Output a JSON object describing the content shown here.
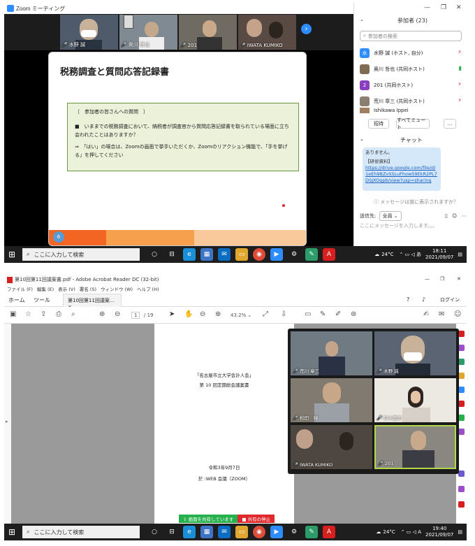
{
  "top": {
    "zoom_title": "Zoom ミーティング",
    "thumbnails": [
      {
        "name": "水野 誠",
        "bg": "#4f5a6a"
      },
      {
        "name": "奥川 哲也",
        "bg": "#7f8a92"
      },
      {
        "name": "201",
        "bg": "#6f6a62"
      },
      {
        "name": "IWATA KUMIKO",
        "bg": "#5a4a44"
      }
    ],
    "slide": {
      "title": "税務調査と質問応答記録書",
      "box_heading": "〔　参加者の皆さんへの質問　〕",
      "box_question": "■　いままでの税務調査において、納税者が調査官から質問応答記録書を取られている場面に立ち会われたことはありますか？",
      "box_instruction": "⇒　「はい」の場合は、Zoomの画面で挙手いただくか、Zoomのリアクション機能で、「手を挙げる」を押してください",
      "page_number": "6",
      "bar_colors": [
        "#f26522",
        "#f6a04d",
        "#f9c99b"
      ]
    },
    "panel": {
      "participants_label": "参加者 (23)",
      "search_placeholder": "参加者の検索",
      "participants": [
        {
          "initial": "水",
          "name": "水野 誠 (ホスト, 自分)",
          "color": "#2d8cff"
        },
        {
          "initial": "",
          "name": "奥川 哲也 (共同ホスト)",
          "color": "#7f6a52"
        },
        {
          "initial": "2",
          "name": "201 (共同ホスト)",
          "color": "#8a3fc0"
        },
        {
          "initial": "",
          "name": "荒川 章三 (共同ホスト)",
          "color": "#8c7f70"
        },
        {
          "initial": "",
          "name": "Ishikawa Ippei",
          "color": "#a08060"
        }
      ],
      "invite_label": "招待",
      "mute_all_label": "すべてミュート",
      "more_label": "...",
      "chat_label": "チャット",
      "chat_text_1": "ありません。",
      "chat_text_2": "【研修資料】",
      "chat_link": "https://drive.google.com/file/d/1eEh9BZvSSLuFhowS9EkR2PL7DSJXOgpb/view?usp=sharing",
      "chat_warning": "メッセージは誰に表示されますか？",
      "send_to_label": "送信先:",
      "send_to_value": "全員",
      "chat_input_placeholder": "ここにメッセージを入力します。。。"
    },
    "taskbar": {
      "search_placeholder": "ここに入力して検索",
      "temp": "24°C",
      "time": "18:11",
      "date": "2021/09/07"
    }
  },
  "bottom": {
    "window_title": "第10回第11回議案書.pdf - Adobe Acrobat Reader DC (32-bit)",
    "menu": [
      "ファイル (F)",
      "編集 (E)",
      "表示 (V)",
      "署名 (S)",
      "ウィンドウ (W)",
      "ヘルプ (H)"
    ],
    "tab_home": "ホーム",
    "tab_tools": "ツール",
    "doc_tab": "第10回第11回議案...",
    "login": "ログイン",
    "page_current": "1",
    "page_total": "/ 19",
    "zoom": "43.2%",
    "page_text": {
      "line1": "「名古屋市立大学会計人会」",
      "line2": "第 10 回定期総会議案書",
      "date": "令和3年9月7日",
      "venue": "於 :WEB 会議（ZOOM）"
    },
    "gallery": [
      {
        "name": "荒川 章三",
        "bg": "#6f7a82"
      },
      {
        "name": "水野 誠",
        "bg": "#5a6472"
      },
      {
        "name": "松田　韓",
        "bg": "#807a70"
      },
      {
        "name": "鈴木里美",
        "bg": "#ece8e2"
      },
      {
        "name": "IWATA KUMIKO",
        "bg": "#4e4640"
      },
      {
        "name": "201",
        "bg": "#8a8680"
      }
    ],
    "share_label": "画面を共有しています",
    "stop_share_label": "共有の停止",
    "taskbar": {
      "search_placeholder": "ここに入力して検索",
      "temp": "24°C",
      "time": "19:40",
      "date": "2021/09/07"
    }
  }
}
